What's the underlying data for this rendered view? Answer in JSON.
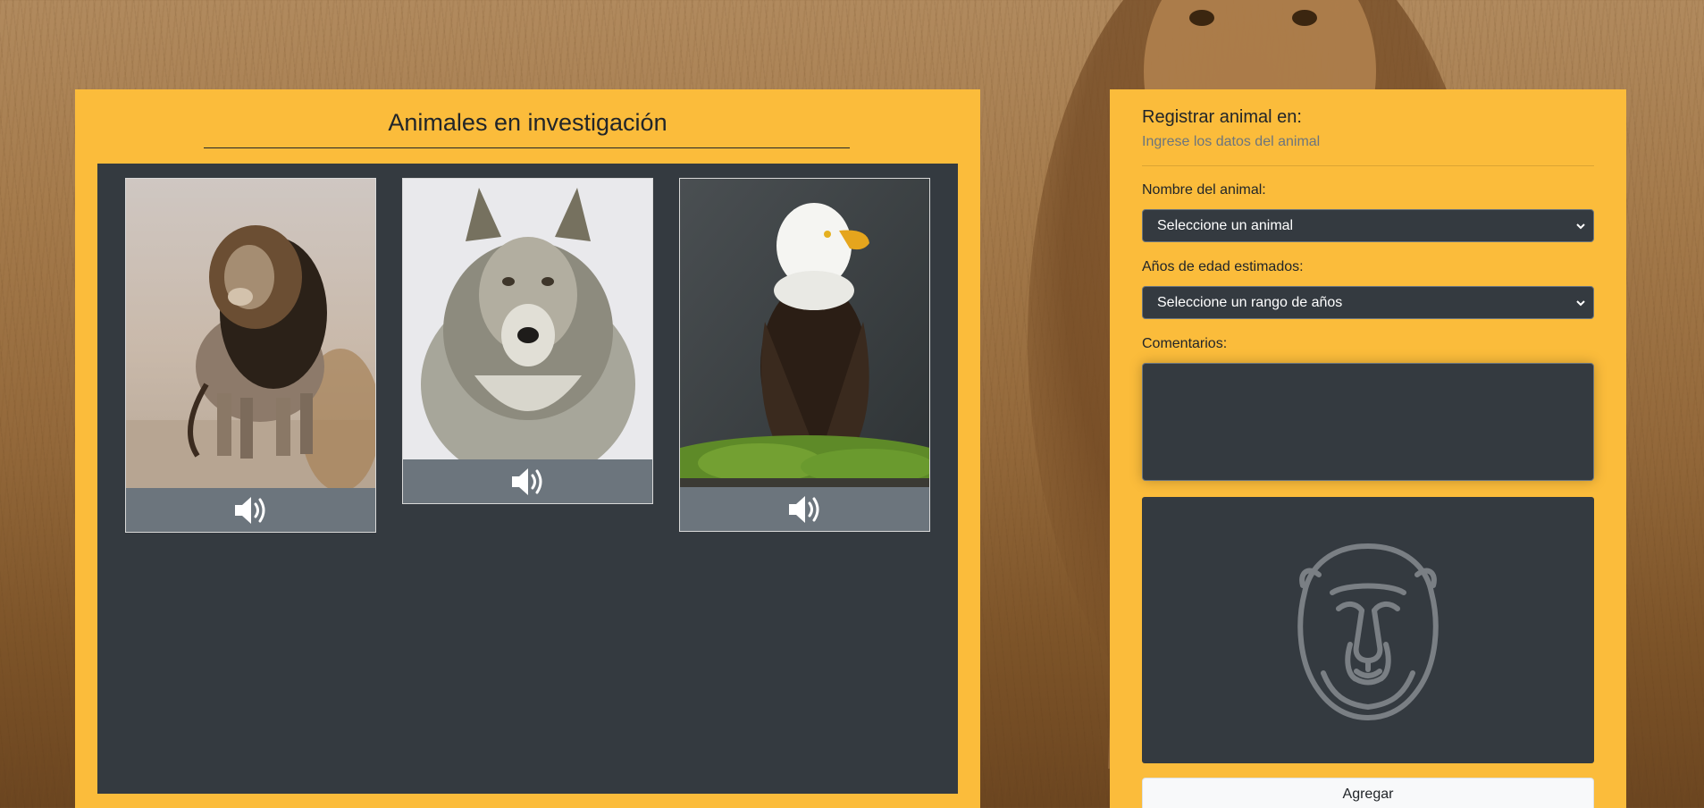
{
  "gallery": {
    "title": "Animales en investigación",
    "animals": [
      {
        "name": "lion",
        "sound_icon": "speaker-icon"
      },
      {
        "name": "wolf",
        "sound_icon": "speaker-icon"
      },
      {
        "name": "eagle",
        "sound_icon": "speaker-icon"
      }
    ]
  },
  "form": {
    "title": "Registrar animal en:",
    "subtitle": "Ingrese los datos del animal",
    "animal_label": "Nombre del animal:",
    "animal_select_value": "Seleccione un animal",
    "age_label": "Años de edad estimados:",
    "age_select_value": "Seleccione un rango de años",
    "comments_label": "Comentarios:",
    "comments_value": "",
    "preview_icon": "lion-outline-icon",
    "add_button_label": "Agregar"
  },
  "colors": {
    "panel": "#fbbc3b",
    "dark": "#343a40",
    "muted": "#6c757d"
  }
}
